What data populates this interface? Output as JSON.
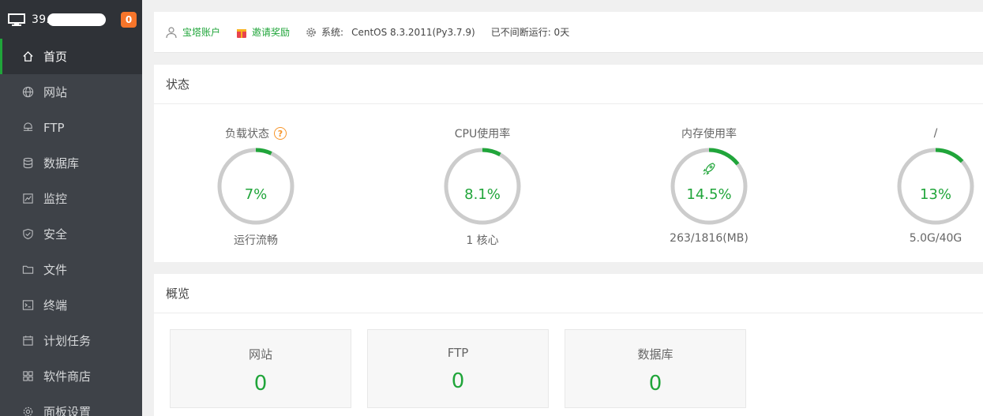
{
  "sidebar": {
    "ip": "39.96.",
    "badge": "0",
    "items": [
      {
        "label": "首页",
        "icon": "home-icon",
        "active": true
      },
      {
        "label": "网站",
        "icon": "globe-icon"
      },
      {
        "label": "FTP",
        "icon": "ftp-icon"
      },
      {
        "label": "数据库",
        "icon": "database-icon"
      },
      {
        "label": "监控",
        "icon": "monitor-chart-icon"
      },
      {
        "label": "安全",
        "icon": "shield-icon"
      },
      {
        "label": "文件",
        "icon": "folder-icon"
      },
      {
        "label": "终端",
        "icon": "terminal-icon"
      },
      {
        "label": "计划任务",
        "icon": "calendar-icon"
      },
      {
        "label": "软件商店",
        "icon": "grid-apps-icon"
      },
      {
        "label": "面板设置",
        "icon": "gear-icon"
      }
    ]
  },
  "topbar": {
    "account": "宝塔账户",
    "invite": "邀请奖励",
    "system_label": "系统:",
    "system_value": "CentOS 8.3.2011(Py3.7.9)",
    "uptime": "已不间断运行: 0天"
  },
  "status": {
    "title": "状态",
    "gauges": [
      {
        "title": "负载状态",
        "value": "7%",
        "percent": 7,
        "sub": "运行流畅",
        "help": "?"
      },
      {
        "title": "CPU使用率",
        "value": "8.1%",
        "percent": 8.1,
        "sub": "1 核心"
      },
      {
        "title": "内存使用率",
        "value": "14.5%",
        "percent": 14.5,
        "sub": "263/1816(MB)"
      },
      {
        "title": "/",
        "value": "13%",
        "percent": 13,
        "sub": "5.0G/40G"
      }
    ]
  },
  "overview": {
    "title": "概览",
    "cards": [
      {
        "label": "网站",
        "value": "0"
      },
      {
        "label": "FTP",
        "value": "0"
      },
      {
        "label": "数据库",
        "value": "0"
      }
    ]
  },
  "colors": {
    "accent": "#20a53a",
    "sidebar_bg": "#3e4248",
    "badge": "#f7752a",
    "ring_track": "#cccccc"
  }
}
